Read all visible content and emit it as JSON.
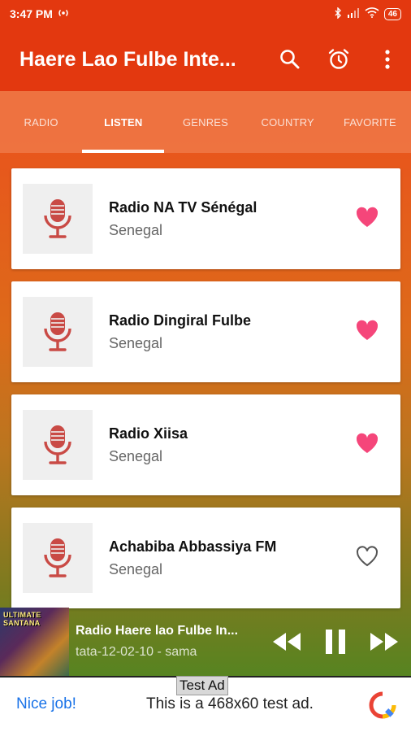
{
  "status": {
    "time": "3:47 PM",
    "battery": "46"
  },
  "app": {
    "title": "Haere Lao Fulbe Inte..."
  },
  "tabs": [
    {
      "label": "RADIO",
      "active": false
    },
    {
      "label": "LISTEN",
      "active": true
    },
    {
      "label": "GENRES",
      "active": false
    },
    {
      "label": "COUNTRY",
      "active": false
    },
    {
      "label": "FAVORITE",
      "active": false
    }
  ],
  "stations": [
    {
      "name": "Radio NA TV Sénégal",
      "country": "Senegal",
      "favorite": true
    },
    {
      "name": "Radio Dingiral Fulbe",
      "country": "Senegal",
      "favorite": true
    },
    {
      "name": "Radio Xiisa",
      "country": "Senegal",
      "favorite": true
    },
    {
      "name": "Achabiba Abbassiya FM",
      "country": "Senegal",
      "favorite": false
    }
  ],
  "player": {
    "album_text": "ULTIMATE SANTANA",
    "title": "Radio Haere lao Fulbe In...",
    "subtitle": "tata-12-02-10 - sama"
  },
  "ad": {
    "label": "Test Ad",
    "nice": "Nice job!",
    "text": "This is a 468x60 test ad."
  },
  "colors": {
    "primary": "#e3380f",
    "heart": "#f5467a",
    "mic": "#c94a45"
  }
}
